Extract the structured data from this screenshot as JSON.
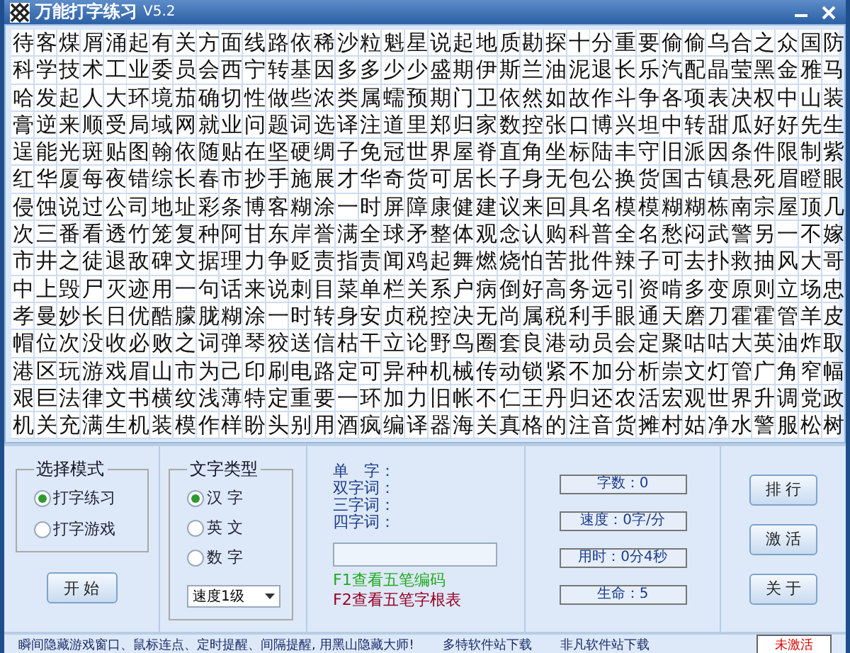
{
  "window": {
    "title": "万能打字练习",
    "version": "V5.2"
  },
  "text_grid": {
    "rows": [
      "待客煤屑涌起有关方面线路依稀沙粒魁星说起地质勘探十分重要偷偷乌合之众国防",
      "科学技术工业委员会西宁转基因多多少少盛期伊斯兰油泥退长乐汽配晶莹黑金雅马",
      "哈发起人大环境茄确切性做些浓类属蠕预期门卫依然如故作斗争各项表决权中山装",
      "膏逆来顺受局域网就业问题词选译注道里郑归家数控张口博兴坦中转甜瓜好好先生",
      "逞能光斑贴图翰依随贴在坚硬绸子免冠世界屋脊直角坐标陆丰守旧派因条件限制紫",
      "红华厦每夜错综长春市抄手施展才华奇货可居长子身无包公换货国古镇悬死眉瞪眼",
      "侵蚀说过公司地址彩条博客糊涂一时屏障康健建议来回具名模模糊糊栋南宗屋顶几",
      "次三番看透竹笼复种阿甘东岸誉满全球矛整体观念认购科普全名愁闷武警另一不嫁",
      "市井之徒退敌碑文据理力争贬责指责闻鸡起舞燃烧怕苦批件辣子可去扑救抽风大哥",
      "中上毁尸灭迹用一句话来说刺目菜单栏关系户病倒好高务远引资啃多变原则立场忠",
      "孝曼妙长日优酷朦胧糊涂一时转身安贞税控决无尚属税利手眼通天磨刀霍霍管羊皮",
      "帽位次没收必败之词弹琴狡送信枯干立论野鸟圈套良港动员会定聚咕咕大英油炸取",
      "港区玩游戏眉山市为己印刷电路定可异种机械传动锁紧不加分析崇文灯管广角窄幅",
      "艰巨法律文书横纹浅薄特定重要一环加力旧帐不仁王丹归还农活宏观世界升调党政",
      "机关充满生机装模作样盼头别用酒疯编译器海关真格的注音货摊村姑净水警服松树"
    ]
  },
  "mode_group": {
    "title": "选择模式",
    "options": [
      {
        "label": "打字练习",
        "selected": true
      },
      {
        "label": "打字游戏",
        "selected": false
      }
    ]
  },
  "start_button": "开 始",
  "text_type_group": {
    "title": "文字类型",
    "options": [
      {
        "label": "汉 字",
        "selected": true
      },
      {
        "label": "英 文",
        "selected": false
      },
      {
        "label": "数 字",
        "selected": false
      }
    ],
    "speed_select": "速度1级"
  },
  "lookup": {
    "labels": [
      "单　字：",
      "双字词：",
      "三字词：",
      "四字词："
    ],
    "hints": [
      {
        "text": "F1查看五笔编码",
        "color": "#22aa22"
      },
      {
        "text": "F2查看五笔字根表",
        "color": "#990022"
      }
    ]
  },
  "stats": [
    "字数：0",
    "速度：0字/分",
    "用时：0分4秒",
    "生命：5"
  ],
  "side_buttons": [
    "排 行",
    "激 活",
    "关 于"
  ],
  "status_bar": {
    "message": "瞬间隐藏游戏窗口、鼠标连点、定时提醒、间隔提醒, 用黑山隐藏大师!",
    "links": [
      "多特软件站下载",
      "非凡软件站下载"
    ],
    "activation": "未激活"
  }
}
